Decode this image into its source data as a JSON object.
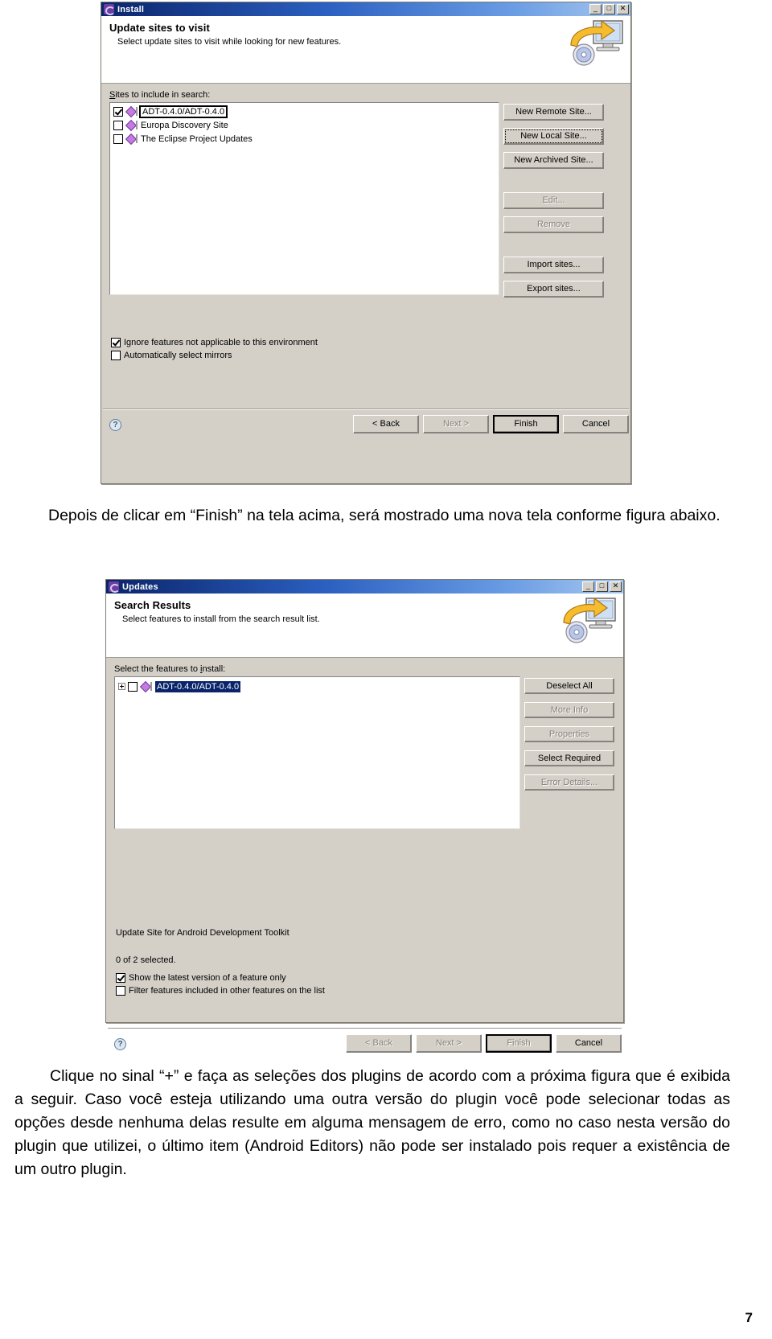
{
  "document": {
    "paragraph_1": "Depois de clicar em “Finish” na tela acima, será mostrado uma nova tela conforme figura abaixo.",
    "paragraph_2": "Clique no sinal “+” e faça as seleções dos plugins de acordo com a próxima figura que é exibida a seguir. Caso você esteja utilizando uma outra versão do plugin você pode selecionar todas as opções desde nenhuma delas resulte em alguma mensagem de erro, como no caso nesta versão do plugin que utilizei, o último item (Android Editors) não pode ser instalado pois requer a existência de um outro plugin.",
    "page_number": "7"
  },
  "install_dialog": {
    "title": "Install",
    "title_icon": "eclipse-icon",
    "window_buttons": [
      {
        "name": "minimize-button",
        "glyph": "_"
      },
      {
        "name": "maximize-button",
        "glyph": "□"
      },
      {
        "name": "close-button",
        "glyph": "✕"
      }
    ],
    "heading": "Update sites to visit",
    "subheading": "Select update sites to visit while looking for new features.",
    "list_label": "Sites to include in search:",
    "sites": [
      {
        "label": "ADT-0.4.0/ADT-0.4.0",
        "checked": true,
        "focused": true
      },
      {
        "label": "Europa Discovery Site",
        "checked": false,
        "focused": false
      },
      {
        "label": "The Eclipse Project Updates",
        "checked": false,
        "focused": false
      }
    ],
    "side_buttons": [
      {
        "label": "New Remote Site...",
        "disabled": false,
        "focused": false
      },
      {
        "label": "New Local Site...",
        "disabled": false,
        "focused": true
      },
      {
        "label": "New Archived Site...",
        "disabled": false,
        "focused": false
      },
      {
        "label": "Edit...",
        "disabled": true,
        "focused": false
      },
      {
        "label": "Remove",
        "disabled": true,
        "focused": false
      },
      {
        "label": "Import sites...",
        "disabled": false,
        "focused": false
      },
      {
        "label": "Export sites...",
        "disabled": false,
        "focused": false
      }
    ],
    "options": [
      {
        "label": "Ignore features not applicable to this environment",
        "checked": true
      },
      {
        "label": "Automatically select mirrors",
        "checked": false
      }
    ],
    "footer_buttons": [
      {
        "label": "< Back",
        "disabled": false,
        "default": false
      },
      {
        "label": "Next >",
        "disabled": true,
        "default": false
      },
      {
        "label": "Finish",
        "disabled": false,
        "default": true
      },
      {
        "label": "Cancel",
        "disabled": false,
        "default": false
      }
    ],
    "help_glyph": "?"
  },
  "updates_dialog": {
    "title": "Updates",
    "title_icon": "eclipse-icon",
    "window_buttons": [
      {
        "name": "minimize-button",
        "glyph": "_"
      },
      {
        "name": "maximize-button",
        "glyph": "□"
      },
      {
        "name": "close-button",
        "glyph": "✕"
      }
    ],
    "heading": "Search Results",
    "subheading": "Select features to install from the search result list.",
    "list_label": "Select the features to install:",
    "features": [
      {
        "label": "ADT-0.4.0/ADT-0.4.0",
        "checked": false,
        "selected": true,
        "expandable": true
      }
    ],
    "side_buttons": [
      {
        "label": "Deselect All",
        "disabled": false
      },
      {
        "label": "More Info",
        "disabled": true
      },
      {
        "label": "Properties",
        "disabled": true
      },
      {
        "label": "Select Required",
        "disabled": false
      },
      {
        "label": "Error Details...",
        "disabled": true
      }
    ],
    "detail_text": "Update Site for Android Development Toolkit",
    "selection_status": "0 of 2 selected.",
    "options": [
      {
        "label": "Show the latest version of a feature only",
        "checked": true
      },
      {
        "label": "Filter features included in other features on the list",
        "checked": false
      }
    ],
    "footer_buttons": [
      {
        "label": "< Back",
        "disabled": true,
        "default": false
      },
      {
        "label": "Next >",
        "disabled": true,
        "default": false
      },
      {
        "label": "Finish",
        "disabled": true,
        "default": true
      },
      {
        "label": "Cancel",
        "disabled": false,
        "default": false
      }
    ],
    "help_glyph": "?"
  }
}
